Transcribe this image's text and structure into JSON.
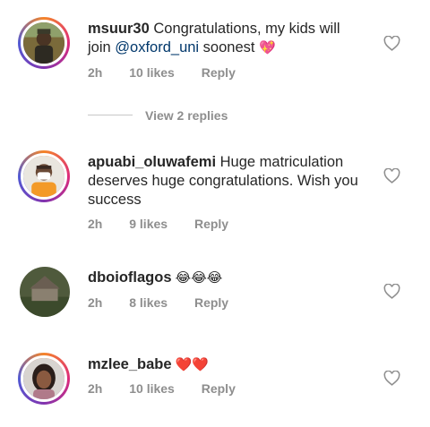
{
  "comments": [
    {
      "username": "msuur30",
      "text_before": " Congratulations, my kids will join ",
      "mention": "@oxford_uni",
      "text_after": " soonest ",
      "emoji": "💖",
      "time": "2h",
      "likes": "10 likes",
      "reply": "Reply"
    },
    {
      "username": "apuabi_oluwafemi",
      "text": " Huge matriculation deserves huge congratulations. Wish you success",
      "time": "2h",
      "likes": "9 likes",
      "reply": "Reply"
    },
    {
      "username": "dboioflagos",
      "emoji": " 😂😂😂",
      "time": "2h",
      "likes": "8 likes",
      "reply": "Reply"
    },
    {
      "username": "mzlee_babe",
      "emoji": " ❤️❤️",
      "time": "2h",
      "likes": "10 likes",
      "reply": "Reply"
    }
  ],
  "view_replies": "View 2 replies",
  "icons": {
    "like": "heart-outline-icon"
  },
  "colors": {
    "meta": "#8e8e8e",
    "mention": "#00376b",
    "text": "#262626"
  }
}
